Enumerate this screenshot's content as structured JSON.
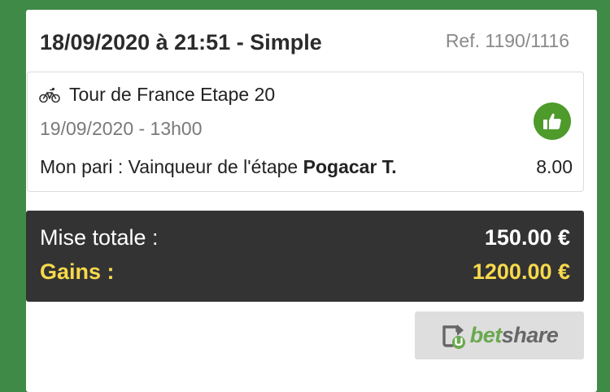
{
  "header": {
    "title": "18/09/2020 à 21:51 - Simple",
    "ref": "Ref. 1190/1116"
  },
  "event": {
    "sport_icon": "bicycle-icon",
    "name": "Tour de France Etape 20",
    "date": "19/09/2020 - 13h00",
    "status_icon": "thumbs-up-icon",
    "status_color": "#4e9a2b"
  },
  "bet": {
    "prefix": "Mon pari : Vainqueur de l'étape ",
    "selection": "Pogacar T.",
    "odds": "8.00"
  },
  "totals": {
    "stake_label": "Mise totale :",
    "stake_value": "150.00 €",
    "gains_label": "Gains :",
    "gains_value": "1200.00 €",
    "gains_color": "#f7d94c"
  },
  "share": {
    "icon": "share-arrow-icon",
    "label_part1": "bet",
    "label_part2": "share"
  },
  "colors": {
    "background": "#3f8a46",
    "totals_bg": "#333333",
    "accent_green": "#6aa84f"
  }
}
